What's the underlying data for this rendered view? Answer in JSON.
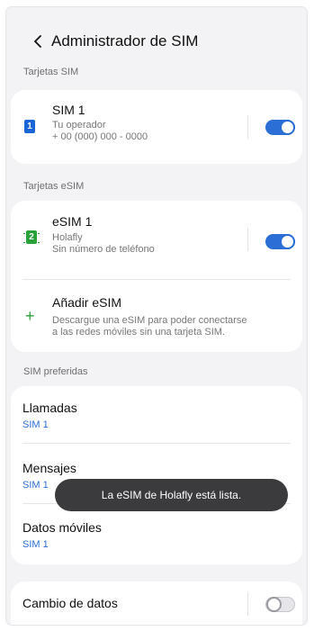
{
  "header": {
    "title": "Administrador de SIM"
  },
  "sections": {
    "sim_cards": "Tarjetas SIM",
    "esim_cards": "Tarjetas eSIM",
    "preferred": "SIM preferidas"
  },
  "sim1": {
    "badge": "1",
    "name": "SIM 1",
    "operator": "Tu operador",
    "number": "+ 00 (000) 000 - 0000",
    "enabled": true
  },
  "esim1": {
    "badge": "2",
    "name": "eSIM 1",
    "operator": "Holafly",
    "number": "Sin número de teléfono",
    "enabled": true
  },
  "add_esim": {
    "icon": "plus-icon",
    "label": "Añadir eSIM",
    "description_line1": "Descargue una eSIM para poder conectarse",
    "description_line2": "a las redes móviles sin una tarjeta SIM."
  },
  "preferred": {
    "calls": {
      "label": "Llamadas",
      "value": "SIM 1"
    },
    "messages": {
      "label": "Mensajes",
      "value": "SIM 1"
    },
    "mobile_data": {
      "label": "Datos móviles",
      "value": "SIM 1"
    }
  },
  "data_switch": {
    "label": "Cambio de datos",
    "enabled": false
  },
  "toast": {
    "text": "La eSIM de Holafly está lista."
  },
  "colors": {
    "accent": "#2b6fd6",
    "sim_blue": "#1a66d8",
    "esim_green": "#2aa23a"
  }
}
